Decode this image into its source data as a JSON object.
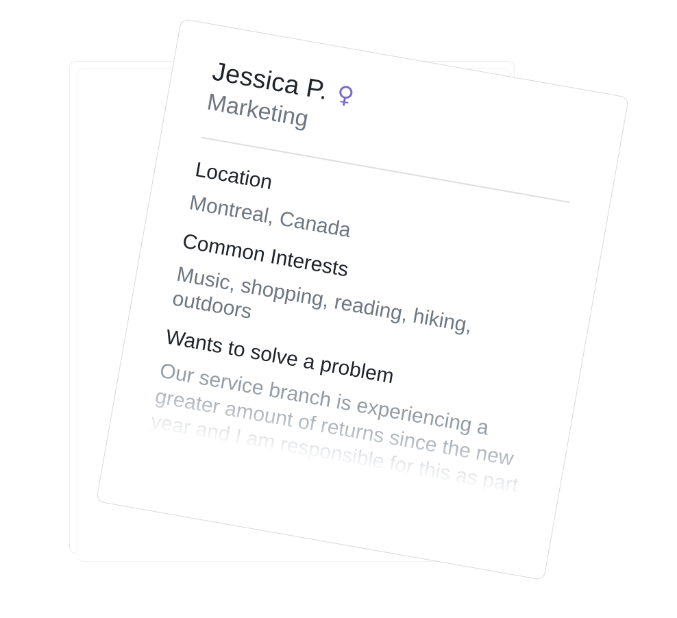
{
  "profile": {
    "name": "Jessica P.",
    "gender_icon": "♀",
    "gender_icon_name": "female-icon",
    "department": "Marketing",
    "location_label": "Location",
    "location_value": "Montreal, Canada",
    "interests_label": "Common Interests",
    "interests_value": "Music, shopping, reading, hiking, outdoors",
    "problem_label": "Wants to solve a problem",
    "problem_value": "Our service branch is experiencing a greater amount of returns since the new year and I am responsible for this as part"
  },
  "colors": {
    "accent": "#7b6ac9",
    "text_primary": "#1f2328",
    "text_secondary": "#6e7781",
    "border": "#d9d9d9"
  }
}
